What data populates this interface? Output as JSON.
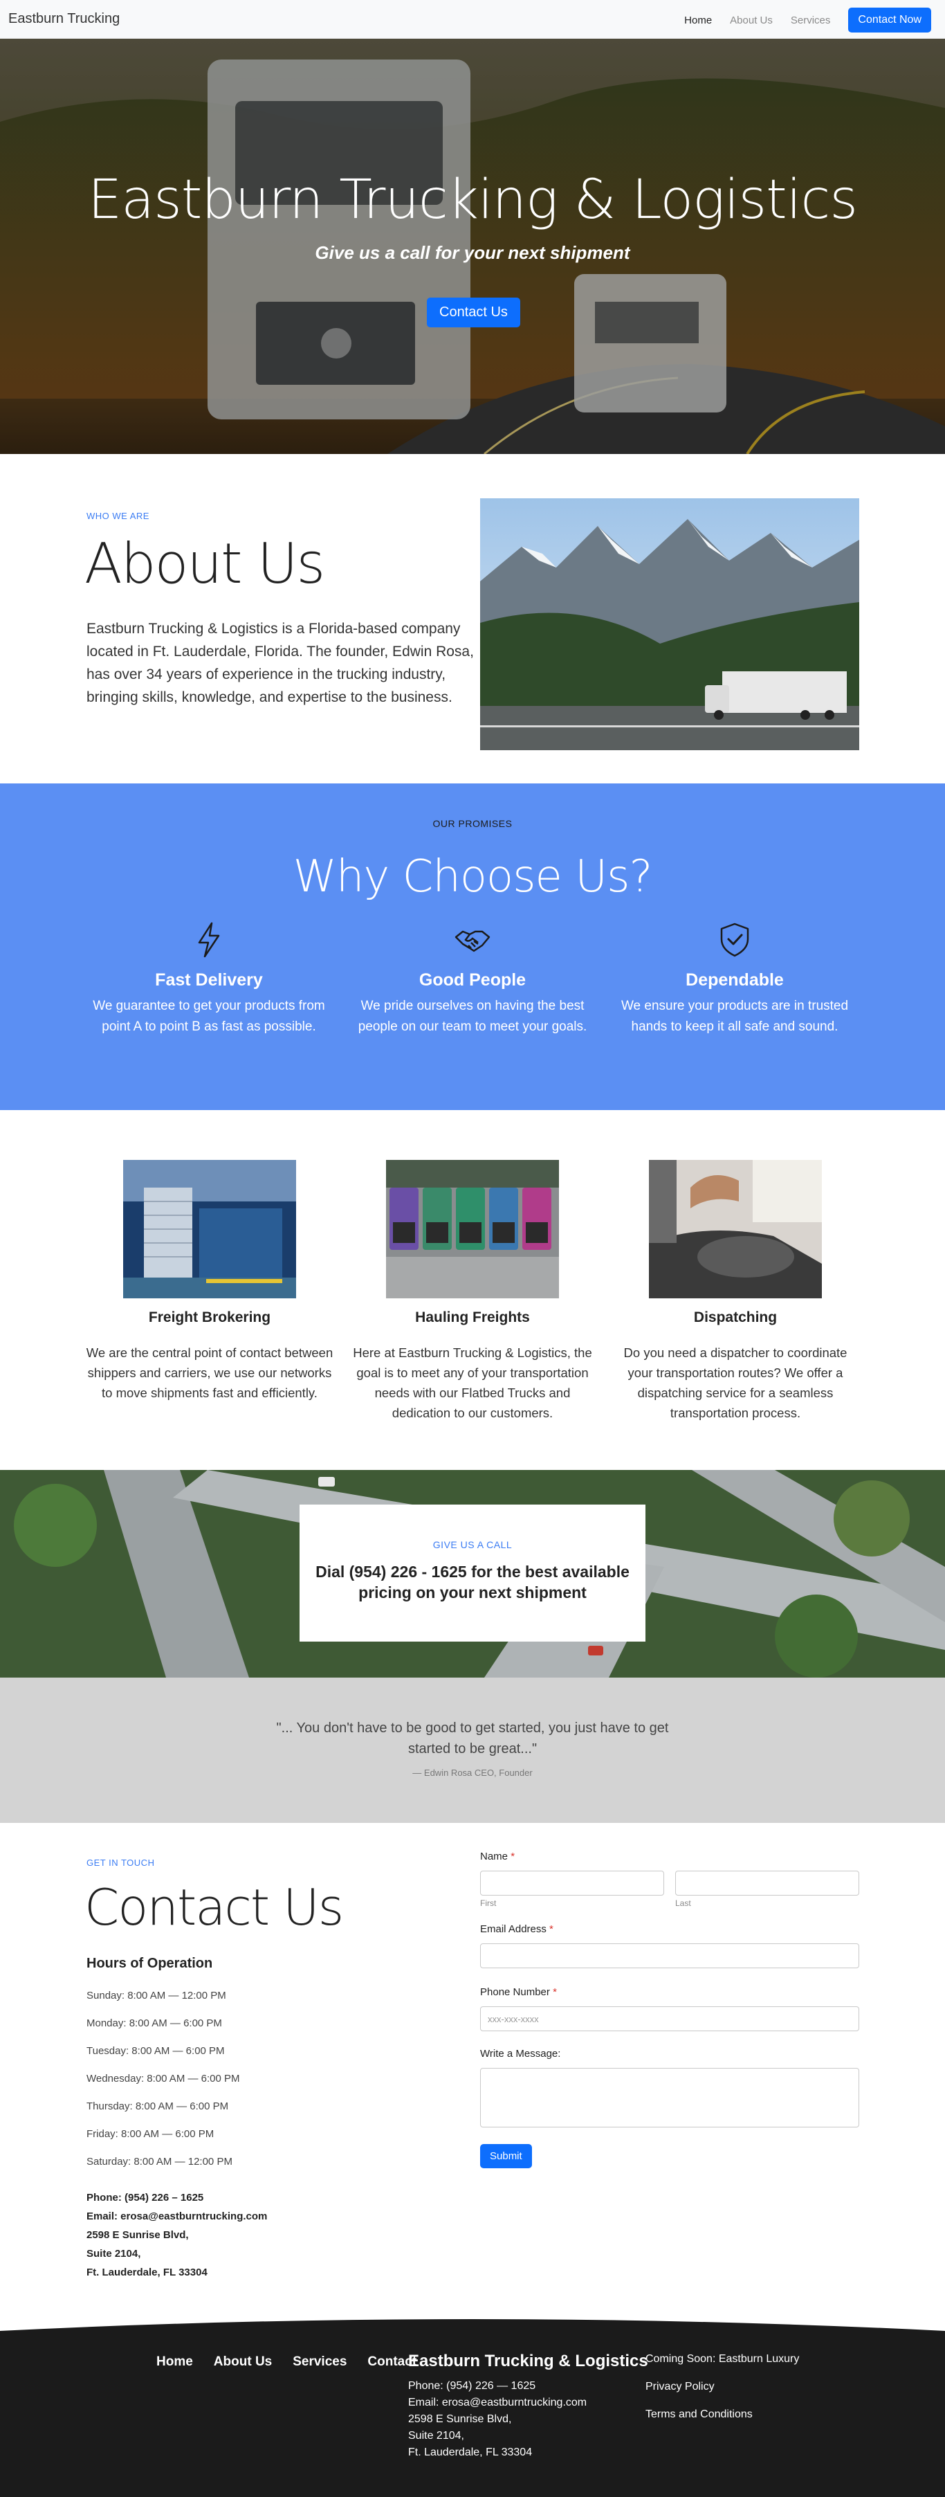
{
  "navbar": {
    "brand": "Eastburn Trucking",
    "links": [
      "Home",
      "About Us",
      "Services"
    ],
    "cta": "Contact Now"
  },
  "hero": {
    "title": "Eastburn Trucking & Logistics",
    "subtitle": "Give us a call for your next shipment",
    "button": "Contact Us"
  },
  "about": {
    "eyebrow": "WHO WE ARE",
    "title": "About Us",
    "text": "Eastburn Trucking & Logistics is a Florida-based company located in Ft. Lauderdale, Florida. The founder, Edwin Rosa, has over 34 years of experience in the trucking industry, bringing skills, knowledge, and expertise to the business."
  },
  "why": {
    "eyebrow": "OUR PROMISES",
    "title": "Why Choose Us?",
    "items": [
      {
        "icon": "lightning-icon",
        "title": "Fast Delivery",
        "text": "We guarantee to get your products from point A to point B as fast as possible."
      },
      {
        "icon": "handshake-icon",
        "title": "Good People",
        "text": "We pride ourselves on having the best people on our team to meet your goals."
      },
      {
        "icon": "shield-check-icon",
        "title": "Dependable",
        "text": "We ensure your products are in trusted hands to keep it all safe and sound."
      }
    ]
  },
  "services": [
    {
      "title": "Freight Brokering",
      "text": "We are the central point of contact between shippers and carriers, we use our networks to move shipments fast and efficiently."
    },
    {
      "title": "Hauling Freights",
      "text": "Here at Eastburn Trucking & Logistics, the goal is to meet any of your transportation needs with our Flatbed Trucks and dedication to our customers."
    },
    {
      "title": "Dispatching",
      "text": "Do you need a dispatcher to coordinate your transportation routes? We offer a dispatching service for a seamless transportation process."
    }
  ],
  "call": {
    "eyebrow": "GIVE US A CALL",
    "text": "Dial (954) 226 - 1625 for the best available pricing on your next shipment"
  },
  "quote": {
    "text": "\"... You don't have to be good to get started, you just have to get started to be great...\"",
    "cite": "— Edwin Rosa CEO, Founder"
  },
  "contact": {
    "eyebrow": "GET IN TOUCH",
    "title": "Contact Us",
    "hours_title": "Hours of Operation",
    "hours": [
      "Sunday: 8:00 AM — 12:00 PM",
      "Monday: 8:00 AM — 6:00 PM",
      "Tuesday: 8:00 AM — 6:00 PM",
      "Wednesday: 8:00 AM — 6:00 PM",
      "Thursday: 8:00 AM — 6:00 PM",
      "Friday: 8:00 AM — 6:00 PM",
      "Saturday: 8:00 AM — 12:00 PM"
    ],
    "phone": "Phone: (954) 226 – 1625",
    "email": "Email: erosa@eastburntrucking.com",
    "address1": "2598 E Sunrise Blvd,",
    "address2": "Suite 2104,",
    "address3": "Ft. Lauderdale, FL 33304"
  },
  "form": {
    "name_label": "Name",
    "first": "First",
    "last": "Last",
    "email_label": "Email Address",
    "phone_label": "Phone Number",
    "phone_placeholder": "xxx-xxx-xxxx",
    "message_label": "Write a Message:",
    "required_mark": "*",
    "submit": "Submit"
  },
  "footer": {
    "nav": [
      "Home",
      "About Us",
      "Services",
      "Contact"
    ],
    "company": "Eastburn Trucking & Logistics",
    "phone": "Phone: (954) 226 — 1625",
    "email": "Email: erosa@eastburntrucking.com",
    "address1": "2598 E Sunrise Blvd,",
    "address2": "Suite 2104,",
    "address3": "Ft. Lauderdale, FL 33304",
    "links": [
      "Coming Soon: Eastburn Luxury",
      "Privacy Policy",
      "Terms and Conditions"
    ]
  },
  "colors": {
    "primary": "#0d6efd",
    "promise_band": "#5b8ff3",
    "accent_text": "#3b7cf3",
    "quote_band": "#d3d3d3",
    "footer": "#1b1b1b"
  }
}
